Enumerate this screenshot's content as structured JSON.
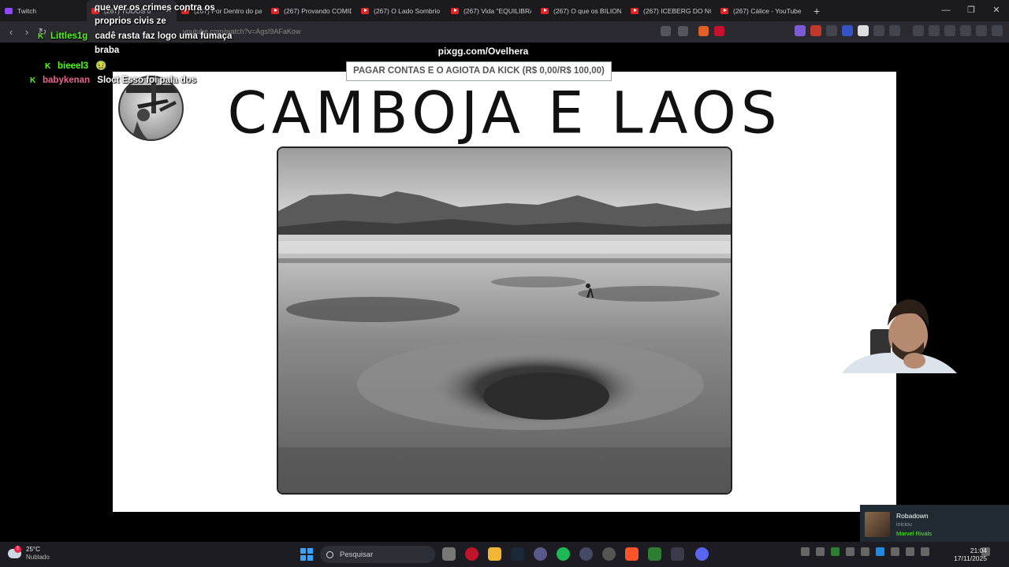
{
  "browser": {
    "tabs": [
      {
        "label": "Twitch",
        "icon": "twitch-icon",
        "active": false
      },
      {
        "label": "(267) TODOS o",
        "icon": "youtube-icon",
        "active": true
      },
      {
        "label": "(267) Por Dentro do pa",
        "icon": "youtube-icon",
        "active": false
      },
      {
        "label": "(267) Provando COMID",
        "icon": "youtube-icon",
        "active": false
      },
      {
        "label": "(267) O Lado Sombrio",
        "icon": "youtube-icon",
        "active": false
      },
      {
        "label": "(267) Vida \"EQUILIBRA",
        "icon": "youtube-icon",
        "active": false
      },
      {
        "label": "(267) O que os BILION",
        "icon": "youtube-icon",
        "active": false
      },
      {
        "label": "(267) ICEBERG DO NO",
        "icon": "youtube-icon",
        "active": false
      },
      {
        "label": "(267) Cálice - YouTube",
        "icon": "youtube-icon",
        "active": false
      }
    ],
    "new_tab": "+",
    "url": "youtube.com/watch?v=AgsI9AFaKow"
  },
  "stream": {
    "pix_url": "pixgg.com/Ovelhera",
    "goal": "PAGAR CONTAS E O AGIOTA DA KICK (R$ 0,00/R$ 100,00)",
    "slide_title": "CAMBOJA E LAOS"
  },
  "chat": [
    {
      "user": "",
      "text": "que ver os crimes contra os"
    },
    {
      "user": "",
      "text": "proprios civis ze"
    },
    {
      "user": "Littles1g",
      "text": "cadê rasta faz logo uma fumaça"
    },
    {
      "user": "",
      "text": "braba"
    },
    {
      "user": "bieeel3",
      "text": "🤢"
    },
    {
      "user": "babykenan",
      "text": "Sloct Esso foi pala dos"
    }
  ],
  "notification": {
    "name": "Robadown",
    "sub": "iniciou",
    "game": "Marvel Rivals"
  },
  "taskbar": {
    "temperature": "25°C",
    "condition": "Nublado",
    "weather_badge": "5",
    "search_placeholder": "Pesquisar",
    "time": "21:04",
    "date": "17/11/2025"
  },
  "colors": {
    "kick_green": "#53fc18",
    "chat_user_pink": "#e8658d",
    "taskbar_bg": "#1c1c22",
    "tab_bg": "#1b1b1f"
  }
}
